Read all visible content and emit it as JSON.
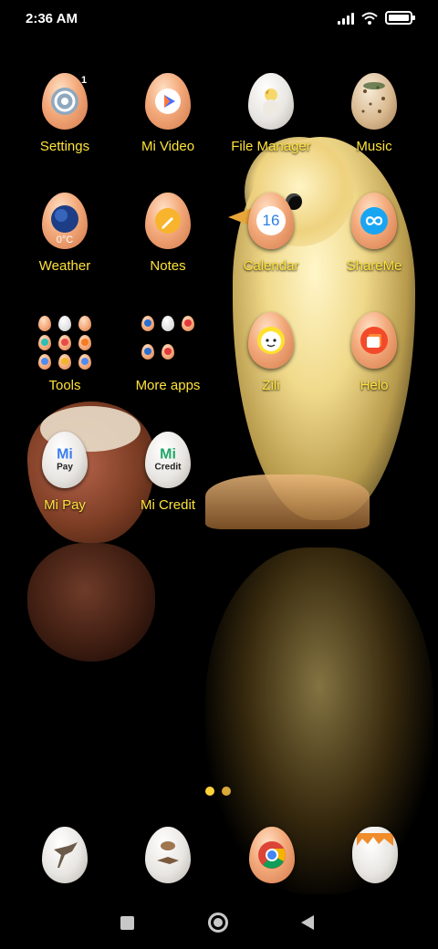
{
  "status_bar": {
    "time": "2:36 AM",
    "icons": [
      "signal-icon",
      "wifi-icon",
      "battery-icon"
    ],
    "battery_level": 1.0
  },
  "apps": {
    "settings": {
      "label": "Settings",
      "badge": "1"
    },
    "mi_video": {
      "label": "Mi Video"
    },
    "file_manager": {
      "label": "File Manager"
    },
    "music": {
      "label": "Music"
    },
    "weather": {
      "label": "Weather",
      "temp": "0°C"
    },
    "notes": {
      "label": "Notes"
    },
    "calendar": {
      "label": "Calendar",
      "day": "16"
    },
    "shareme": {
      "label": "ShareMe"
    },
    "tools": {
      "label": "Tools"
    },
    "more_apps": {
      "label": "More apps"
    },
    "zili": {
      "label": "Zili"
    },
    "helo": {
      "label": "Helo"
    },
    "mi_pay": {
      "label": "Mi Pay",
      "mark": "Mi",
      "sub": "Pay"
    },
    "mi_credit": {
      "label": "Mi Credit",
      "mark": "Mi",
      "sub": "Credit"
    }
  },
  "page_indicator": {
    "count": 2,
    "active": 1
  },
  "dock": [
    "dock-app-bird",
    "dock-app-bird-2",
    "chrome-icon",
    "dock-app-cracked-egg"
  ],
  "colors": {
    "label": "#ffe23a",
    "egg": "#f3a97a",
    "background": "#000000"
  }
}
